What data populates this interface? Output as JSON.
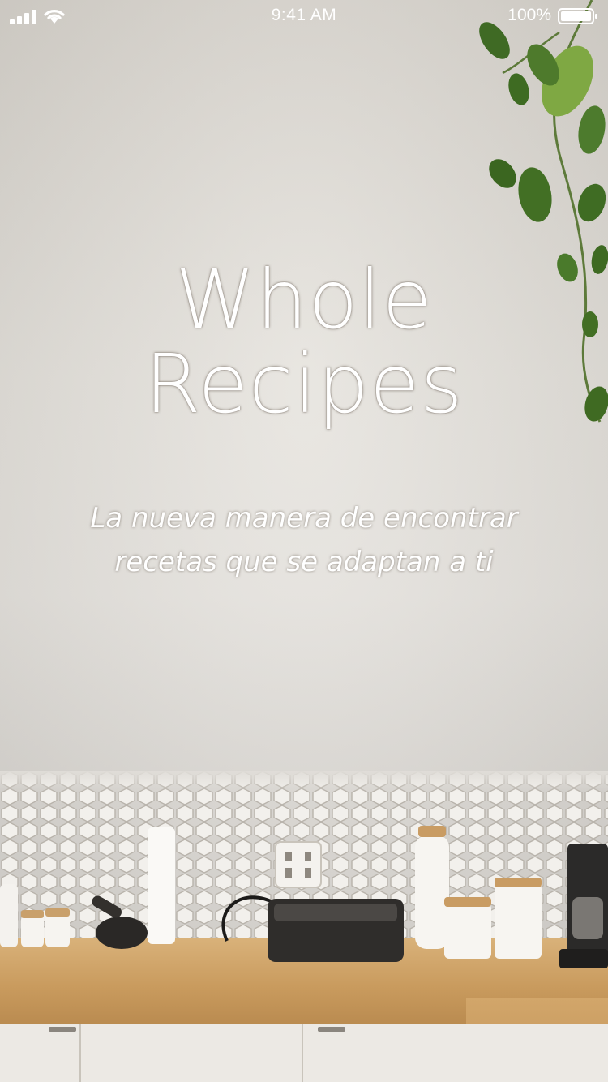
{
  "status_bar": {
    "time": "9:41 AM",
    "battery_percent": "100%",
    "battery_level": 1.0,
    "signal_bars": 4
  },
  "hero": {
    "title_line1": "Whole",
    "title_line2": "Recipes",
    "subtitle_line1": "La nueva manera de encontrar",
    "subtitle_line2": "recetas que se adaptan a ti"
  },
  "background": {
    "image_description_icon": "kitchen-photo",
    "wall_color": "#e4e1db",
    "counter_color": "#d9b27a"
  },
  "icons": {
    "signal": "cellular-signal-icon",
    "wifi": "wifi-icon",
    "battery": "battery-icon"
  },
  "colors": {
    "text": "#ffffff"
  }
}
